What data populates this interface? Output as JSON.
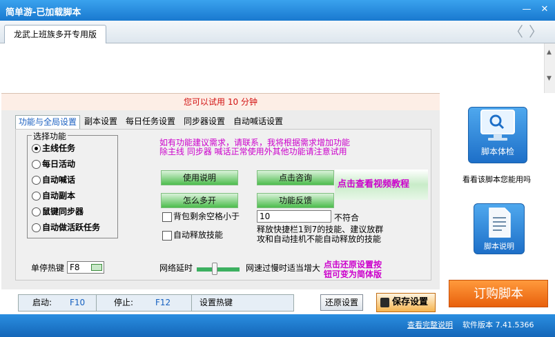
{
  "window": {
    "title": "简单游-已加载脚本",
    "minimize": "—",
    "close": "✕"
  },
  "browser": {
    "tab_label": "龙武上班族多开专用版",
    "back": "〈",
    "forward": "〉"
  },
  "scroll": {
    "up": "▲",
    "down": "▼"
  },
  "trial_text": "您可以试用 10 分钟",
  "tabs": [
    "功能与全局设置",
    "副本设置",
    "每日任务设置",
    "同步器设置",
    "自动喊话设置"
  ],
  "function_group": {
    "legend": "选择功能",
    "options": [
      "主线任务",
      "每日活动",
      "自动喊话",
      "自动副本",
      "鼠键同步器",
      "自动做活跃任务"
    ],
    "selected_index": 0
  },
  "notice_lines": [
    "如有功能建议需求，请联系，我将根据需求增加功能",
    "除主线 同步器 喊话正常使用外其他功能请注意试用"
  ],
  "buttons": {
    "usage": "使用说明",
    "consult": "点击咨询",
    "multi": "怎么多开",
    "feedback": "功能反馈"
  },
  "video_link": "点击查看视频教程",
  "bag_check": {
    "label": "背包剩余空格小于",
    "value": "10",
    "suffix": "不符合"
  },
  "auto_skill": {
    "label": "自动释放技能",
    "note_lines": [
      "释放快捷栏1到7的技能、建议放群",
      "攻和自动挂机不能自动释放的技能"
    ]
  },
  "pause_hotkey": {
    "label": "单停热键",
    "value": "F8"
  },
  "latency": {
    "label": "网络延时",
    "hint": "网速过慢时适当增大",
    "level": 0.42
  },
  "restore_tip_lines": [
    "点击还原设置按",
    "钮可变为简体版"
  ],
  "bottom": {
    "start_label": "启动:",
    "start_key": "F10",
    "stop_label": "停止:",
    "stop_key": "F12",
    "set_hotkey": "设置热键"
  },
  "restore_button": "还原设置",
  "save_button": "保存设置",
  "side": {
    "check_label": "脚本体检",
    "check_desc": "看看该脚本您能用吗",
    "doc_label": "脚本说明"
  },
  "order_button": "订购脚本",
  "status": {
    "link": "查看完整说明",
    "version": "软件版本 7.41.5366"
  },
  "colors": {
    "title_bar": "#1979cf",
    "trial_text": "#d21010",
    "purple_text": "#cc00cc",
    "green_button": "#4cbc4c",
    "order": "#e8600c"
  }
}
